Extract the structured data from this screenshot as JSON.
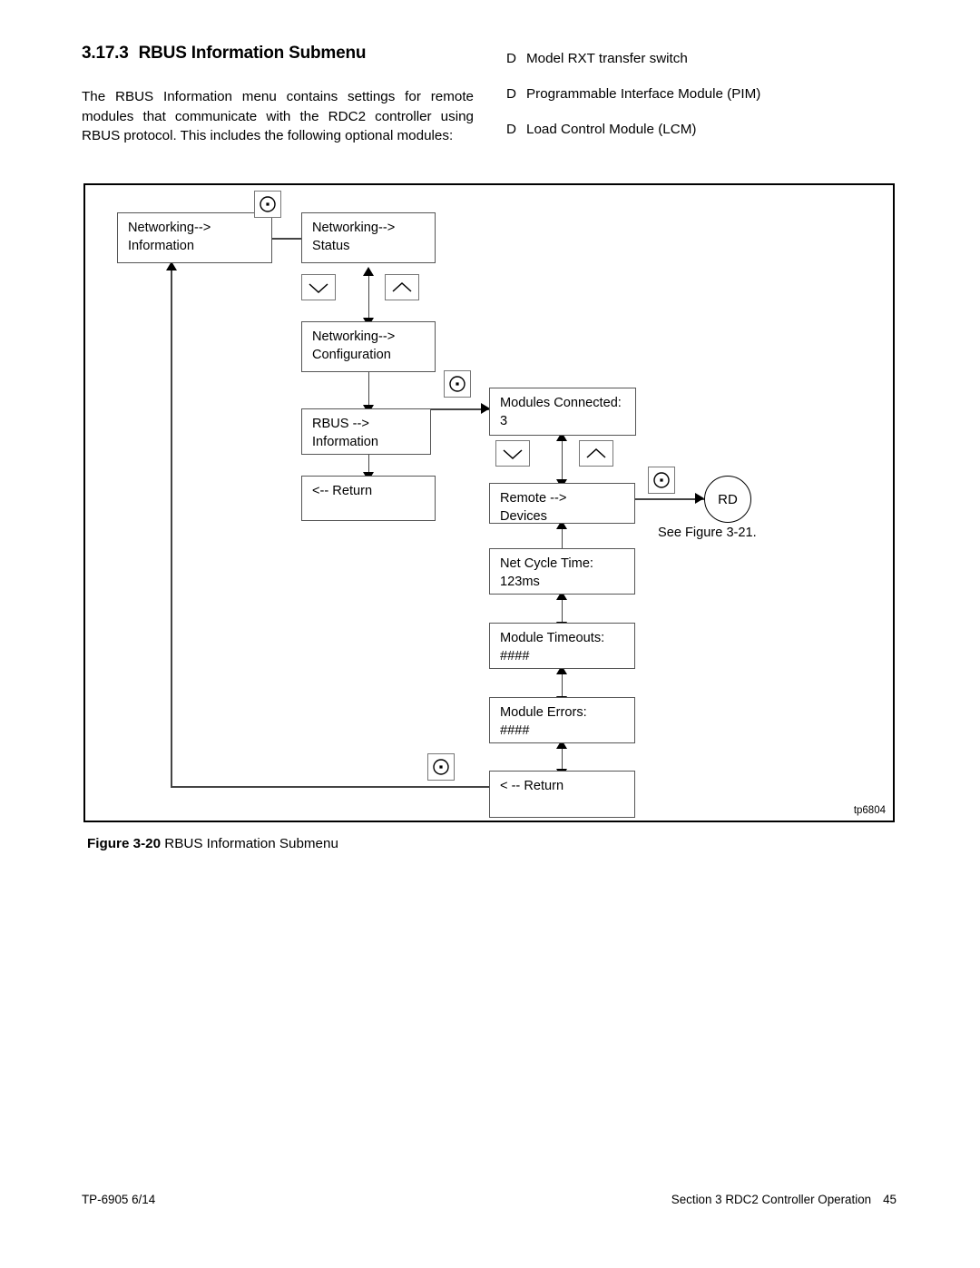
{
  "heading": {
    "number": "3.17.3",
    "title": "RBUS Information Submenu"
  },
  "intro_paragraph": "The RBUS Information menu contains settings for remote modules that communicate with the RDC2 controller using RBUS protocol. This includes the following optional modules:",
  "module_list": {
    "bullet_glyph": "D",
    "items": [
      "Model RXT transfer switch",
      "Programmable Interface Module (PIM)",
      "Load Control Module (LCM)"
    ]
  },
  "figure": {
    "id_label": "tp6804",
    "caption_label": "Figure 3-20",
    "caption_text": "RBUS Information Submenu",
    "nodes": [
      {
        "key": "networking_information",
        "text": "Networking-->\nInformation"
      },
      {
        "key": "networking_status",
        "text": "Networking-->\nStatus"
      },
      {
        "key": "networking_configuration",
        "text": "Networking-->\nConfiguration"
      },
      {
        "key": "rbus_information",
        "text": "RBUS -->\nInformation"
      },
      {
        "key": "return_left",
        "text": "<-- Return"
      },
      {
        "key": "modules_connected",
        "text": "Modules Connected:\n3"
      },
      {
        "key": "remote_devices",
        "text": "Remote -->\nDevices"
      },
      {
        "key": "net_cycle_time",
        "text": "Net Cycle Time:\n123ms"
      },
      {
        "key": "module_timeouts",
        "text": "Module Timeouts:\n####"
      },
      {
        "key": "module_errors",
        "text": "Module Errors:\n####"
      },
      {
        "key": "return_right",
        "text": "< -- Return"
      }
    ],
    "terminator": {
      "label": "RD",
      "note": "See Figure 3-21."
    },
    "keys": {
      "select": "select-key",
      "down": "down-arrow-key",
      "up": "up-arrow-key"
    }
  },
  "footer": {
    "left": "TP-6905 6/14",
    "section": "Section 3  RDC2 Controller Operation",
    "page": "45"
  },
  "colors": {
    "ink": "#000000",
    "box_border": "#555555",
    "connector": "#444444",
    "page_bg": "#ffffff"
  }
}
